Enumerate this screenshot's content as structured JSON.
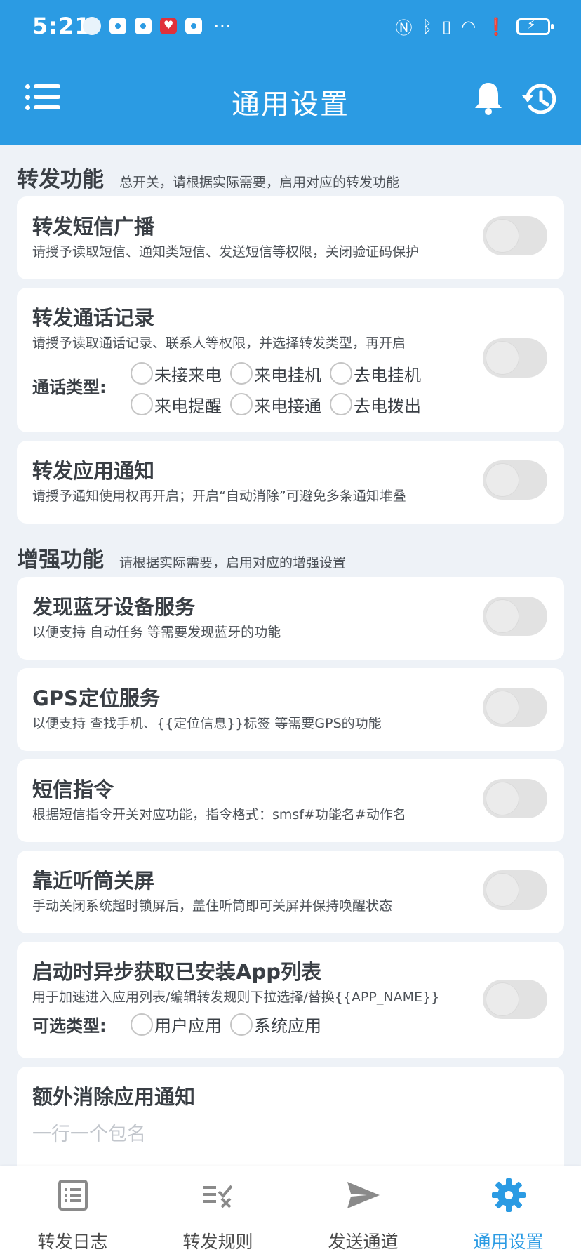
{
  "status_bar": {
    "time": "5:21"
  },
  "app_bar": {
    "title": "通用设置"
  },
  "sections": {
    "forward": {
      "title": "转发功能",
      "subtitle": "总开关，请根据实际需要，启用对应的转发功能",
      "sms": {
        "title": "转发短信广播",
        "desc": "请授予读取短信、通知类短信、发送短信等权限，关闭验证码保护",
        "enabled": false
      },
      "call": {
        "title": "转发通话记录",
        "desc": "请授予读取通话记录、联系人等权限，并选择转发类型，再开启",
        "type_label": "通话类型:",
        "types": [
          "未接来电",
          "来电挂机",
          "去电挂机",
          "来电提醒",
          "来电接通",
          "去电拨出"
        ],
        "enabled": false
      },
      "app_notify": {
        "title": "转发应用通知",
        "desc": "请授予通知使用权再开启；开启“自动消除”可避免多条通知堆叠",
        "enabled": false
      }
    },
    "enhance": {
      "title": "增强功能",
      "subtitle": "请根据实际需要，启用对应的增强设置",
      "bluetooth": {
        "title": "发现蓝牙设备服务",
        "desc": "以便支持 自动任务 等需要发现蓝牙的功能",
        "enabled": false
      },
      "gps": {
        "title": "GPS定位服务",
        "desc": "以便支持 查找手机、{{定位信息}}标签 等需要GPS的功能",
        "enabled": false
      },
      "sms_cmd": {
        "title": "短信指令",
        "desc": "根据短信指令开关对应功能，指令格式：smsf#功能名#动作名",
        "enabled": false
      },
      "proximity": {
        "title": "靠近听筒关屏",
        "desc": "手动关闭系统超时锁屏后，盖住听筒即可关屏并保持唤醒状态",
        "enabled": false
      },
      "app_list": {
        "title": "启动时异步获取已安装App列表",
        "desc": "用于加速进入应用列表/编辑转发规则下拉选择/替换{{APP_NAME}}",
        "type_label": "可选类型:",
        "types": [
          "用户应用",
          "系统应用"
        ],
        "enabled": false
      },
      "extra_cancel": {
        "title": "额外消除应用通知",
        "placeholder": "一行一个包名"
      }
    }
  },
  "bottom_nav": {
    "items": [
      "转发日志",
      "转发规则",
      "发送通道",
      "通用设置"
    ],
    "active": 3
  },
  "colors": {
    "primary": "#2b9be3",
    "background": "#eef2f7"
  }
}
